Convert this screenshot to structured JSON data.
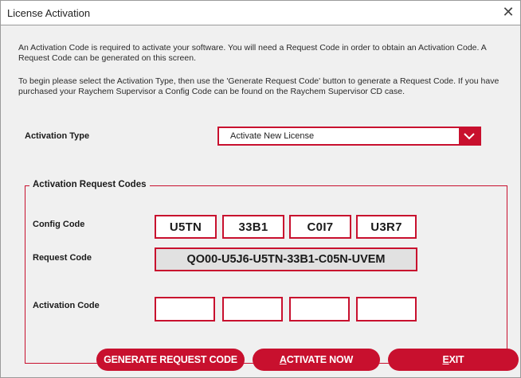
{
  "window": {
    "title": "License Activation"
  },
  "intro": {
    "p1": "An Activation Code is required to activate your software.  You will need a Request Code in order to obtain an Activation Code.  A Request Code can be generated on this screen.",
    "p2": "To begin please select the Activation Type, then use the 'Generate Request Code' button to generate a Request Code.  If you have purchased your Raychem Supervisor a Config Code can be found on the Raychem Supervisor CD case."
  },
  "activation_type": {
    "label": "Activation Type",
    "selected": "Activate New License"
  },
  "request_group": {
    "title": "Activation Request Codes",
    "config_label": "Config Code",
    "config_codes": [
      "U5TN",
      "33B1",
      "C0I7",
      "U3R7"
    ],
    "request_label": "Request Code",
    "request_code": "QO00-U5J6-U5TN-33B1-C05N-UVEM",
    "activation_label": "Activation Code",
    "activation_codes": [
      "",
      "",
      "",
      ""
    ]
  },
  "buttons": {
    "generate": "GENERATE REQUEST CODE",
    "activate_first": "A",
    "activate_rest": "CTIVATE NOW",
    "exit_first": "E",
    "exit_rest": "XIT"
  },
  "colors": {
    "accent": "#c8102e",
    "background": "#f0f0f0"
  }
}
